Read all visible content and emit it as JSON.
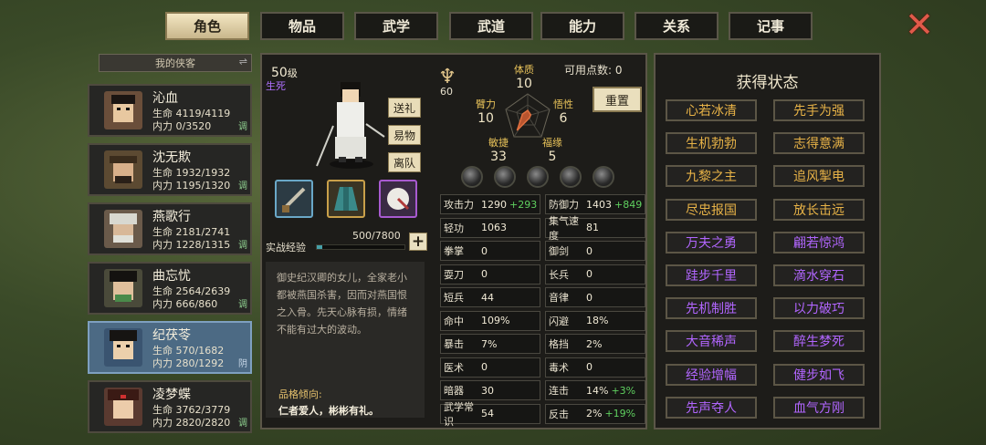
{
  "tabs": [
    "角色",
    "物品",
    "武学",
    "武道",
    "能力",
    "关系",
    "记事"
  ],
  "sidebar": {
    "header": "我的侠客",
    "heroes": [
      {
        "name": "沁血",
        "hp": "生命 4119/4119",
        "mp": "内力 0/3520",
        "tag": "调"
      },
      {
        "name": "沈无欺",
        "hp": "生命 1932/1932",
        "mp": "内力 1195/1320",
        "tag": "调"
      },
      {
        "name": "燕歌行",
        "hp": "生命 2181/2741",
        "mp": "内力 1228/1315",
        "tag": "调"
      },
      {
        "name": "曲忘忧",
        "hp": "生命 2564/2639",
        "mp": "内力 666/860",
        "tag": "调"
      },
      {
        "name": "纪茯苓",
        "hp": "生命 570/1682",
        "mp": "内力 280/1292",
        "tag": "阴"
      },
      {
        "name": "凌梦蝶",
        "hp": "生命 3762/3779",
        "mp": "内力 2820/2820",
        "tag": "调"
      }
    ]
  },
  "character": {
    "level_num": "50",
    "level_unit": "级",
    "status": "生死",
    "buttons": [
      "送礼",
      "易物",
      "离队"
    ],
    "xp_label": "实战经验",
    "xp_text": "500/7800",
    "xp_fraction": 0.064,
    "plus": "+",
    "description": "御史纪汉卿的女儿，全家老小都被燕国杀害，因而对燕国恨之入骨。先天心脉有损，情绪不能有过大的波动。",
    "trait_label": "品格倾向:",
    "trait_text": "仁者爱人，彬彬有礼。"
  },
  "attributes": {
    "medal_value": "60",
    "points_label": "可用点数: 0",
    "reset": "重置",
    "list": [
      {
        "name": "体质",
        "value": "10"
      },
      {
        "name": "臂力",
        "value": "10"
      },
      {
        "name": "悟性",
        "value": "6"
      },
      {
        "name": "敏捷",
        "value": "33"
      },
      {
        "name": "福缘",
        "value": "5"
      }
    ]
  },
  "stats": [
    {
      "label": "攻击力",
      "value": "1290",
      "bonus": "+293"
    },
    {
      "label": "防御力",
      "value": "1403",
      "bonus": "+849"
    },
    {
      "label": "轻功",
      "value": "1063",
      "bonus": ""
    },
    {
      "label": "集气速度",
      "value": "81",
      "bonus": ""
    },
    {
      "label": "拳掌",
      "value": "0",
      "bonus": ""
    },
    {
      "label": "御剑",
      "value": "0",
      "bonus": ""
    },
    {
      "label": "耍刀",
      "value": "0",
      "bonus": ""
    },
    {
      "label": "长兵",
      "value": "0",
      "bonus": ""
    },
    {
      "label": "短兵",
      "value": "44",
      "bonus": ""
    },
    {
      "label": "音律",
      "value": "0",
      "bonus": ""
    },
    {
      "label": "命中",
      "value": "109%",
      "bonus": ""
    },
    {
      "label": "闪避",
      "value": "18%",
      "bonus": ""
    },
    {
      "label": "暴击",
      "value": "7%",
      "bonus": ""
    },
    {
      "label": "格挡",
      "value": "2%",
      "bonus": ""
    },
    {
      "label": "医术",
      "value": "0",
      "bonus": ""
    },
    {
      "label": "毒术",
      "value": "0",
      "bonus": ""
    },
    {
      "label": "暗器",
      "value": "30",
      "bonus": ""
    },
    {
      "label": "连击",
      "value": "14%",
      "bonus": "+3%"
    },
    {
      "label": "武学常识",
      "value": "54",
      "bonus": ""
    },
    {
      "label": "反击",
      "value": "2%",
      "bonus": "+19%"
    }
  ],
  "states": {
    "title": "获得状态",
    "items": [
      {
        "text": "心若冰清",
        "color": "#e8b347"
      },
      {
        "text": "先手为强",
        "color": "#e8b347"
      },
      {
        "text": "生机勃勃",
        "color": "#e8b347"
      },
      {
        "text": "志得意满",
        "color": "#e8b347"
      },
      {
        "text": "九黎之主",
        "color": "#e8b347"
      },
      {
        "text": "追风掣电",
        "color": "#e8b347"
      },
      {
        "text": "尽忠报国",
        "color": "#e8b347"
      },
      {
        "text": "放长击远",
        "color": "#e8b347"
      },
      {
        "text": "万夫之勇",
        "color": "#b266ff"
      },
      {
        "text": "翩若惊鸿",
        "color": "#b266ff"
      },
      {
        "text": "跬步千里",
        "color": "#b266ff"
      },
      {
        "text": "滴水穿石",
        "color": "#b266ff"
      },
      {
        "text": "先机制胜",
        "color": "#b266ff"
      },
      {
        "text": "以力破巧",
        "color": "#b266ff"
      },
      {
        "text": "大音稀声",
        "color": "#b266ff"
      },
      {
        "text": "醉生梦死",
        "color": "#b266ff"
      },
      {
        "text": "经验增幅",
        "color": "#b266ff"
      },
      {
        "text": "健步如飞",
        "color": "#b266ff"
      },
      {
        "text": "先声夺人",
        "color": "#b266ff"
      },
      {
        "text": "血气方刚",
        "color": "#b266ff"
      }
    ]
  }
}
